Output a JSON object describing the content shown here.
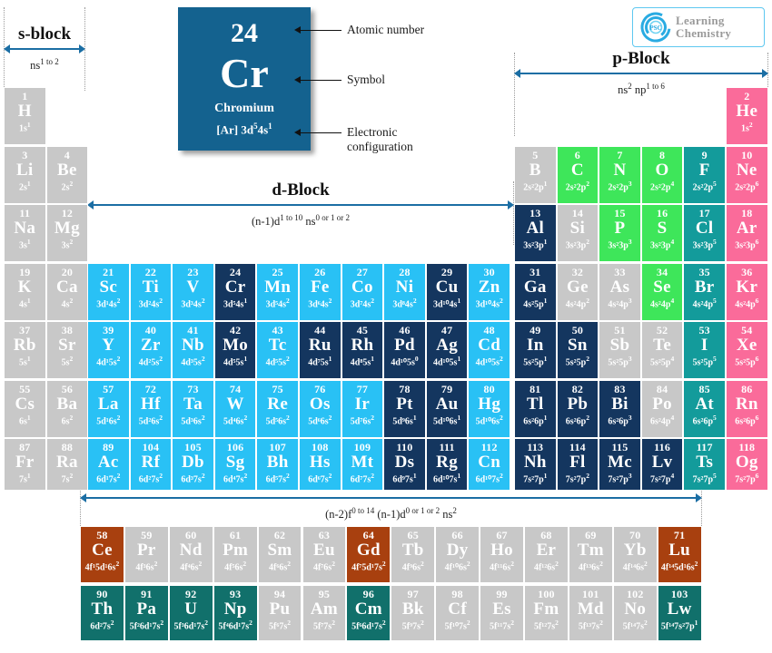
{
  "logo": {
    "mark": "PSC",
    "line1": "Learning",
    "line2": "Chemistry"
  },
  "legend": {
    "atomic_number": "24",
    "symbol": "Cr",
    "name": "Chromium",
    "configuration": "[Ar] 3d5 4s1",
    "configuration_display": "[Ar] 3d⁵4s¹",
    "callout_atomic_number": "Atomic number",
    "callout_symbol": "Symbol",
    "callout_config_line1": "Electronic",
    "callout_config_line2": "configuration"
  },
  "blocks": {
    "s": {
      "title": "s-block",
      "sub": "ns1 to 2"
    },
    "p": {
      "title": "p-Block",
      "sub": "ns2 np1 to 6"
    },
    "d": {
      "title": "d-Block",
      "sub": "(n-1)d1 to 10 ns0 or 1 or 2"
    },
    "f": {
      "title": "f-Block",
      "sub": "(n-2)f0 to 14 (n-1)d0 or 1 or 2 ns2"
    }
  },
  "elements": [
    {
      "z": "1",
      "sym": "H",
      "cfg": "1s",
      "sup": "1",
      "color": "grey",
      "col": 1,
      "row": 1
    },
    {
      "z": "2",
      "sym": "He",
      "cfg": "1s",
      "sup": "2",
      "color": "pink",
      "col": 18,
      "row": 1
    },
    {
      "z": "3",
      "sym": "Li",
      "cfg": "2s",
      "sup": "1",
      "color": "grey",
      "col": 1,
      "row": 2
    },
    {
      "z": "4",
      "sym": "Be",
      "cfg": "2s",
      "sup": "2",
      "color": "grey",
      "col": 2,
      "row": 2
    },
    {
      "z": "5",
      "sym": "B",
      "cfg": "2s²2p",
      "sup": "1",
      "color": "grey",
      "col": 13,
      "row": 2
    },
    {
      "z": "6",
      "sym": "C",
      "cfg": "2s²2p",
      "sup": "2",
      "color": "green",
      "col": 14,
      "row": 2
    },
    {
      "z": "7",
      "sym": "N",
      "cfg": "2s²2p",
      "sup": "3",
      "color": "green",
      "col": 15,
      "row": 2
    },
    {
      "z": "8",
      "sym": "O",
      "cfg": "2s²2p",
      "sup": "4",
      "color": "green",
      "col": 16,
      "row": 2
    },
    {
      "z": "9",
      "sym": "F",
      "cfg": "2s²2p",
      "sup": "5",
      "color": "teal",
      "col": 17,
      "row": 2
    },
    {
      "z": "10",
      "sym": "Ne",
      "cfg": "2s²2p",
      "sup": "6",
      "color": "pink",
      "col": 18,
      "row": 2
    },
    {
      "z": "11",
      "sym": "Na",
      "cfg": "3s",
      "sup": "1",
      "color": "grey",
      "col": 1,
      "row": 3
    },
    {
      "z": "12",
      "sym": "Mg",
      "cfg": "3s",
      "sup": "2",
      "color": "grey",
      "col": 2,
      "row": 3
    },
    {
      "z": "13",
      "sym": "Al",
      "cfg": "3s²3p",
      "sup": "1",
      "color": "navy",
      "col": 13,
      "row": 3
    },
    {
      "z": "14",
      "sym": "Si",
      "cfg": "3s²3p",
      "sup": "2",
      "color": "grey",
      "col": 14,
      "row": 3
    },
    {
      "z": "15",
      "sym": "P",
      "cfg": "3s²3p",
      "sup": "3",
      "color": "green",
      "col": 15,
      "row": 3
    },
    {
      "z": "16",
      "sym": "S",
      "cfg": "3s²3p",
      "sup": "4",
      "color": "green",
      "col": 16,
      "row": 3
    },
    {
      "z": "17",
      "sym": "Cl",
      "cfg": "3s²3p",
      "sup": "5",
      "color": "teal",
      "col": 17,
      "row": 3
    },
    {
      "z": "18",
      "sym": "Ar",
      "cfg": "3s²3p",
      "sup": "6",
      "color": "pink",
      "col": 18,
      "row": 3
    },
    {
      "z": "19",
      "sym": "K",
      "cfg": "4s",
      "sup": "1",
      "color": "grey",
      "col": 1,
      "row": 4
    },
    {
      "z": "20",
      "sym": "Ca",
      "cfg": "4s",
      "sup": "2",
      "color": "grey",
      "col": 2,
      "row": 4
    },
    {
      "z": "21",
      "sym": "Sc",
      "cfg": "3d¹4s",
      "sup": "2",
      "color": "cyan",
      "col": 3,
      "row": 4
    },
    {
      "z": "22",
      "sym": "Ti",
      "cfg": "3d²4s",
      "sup": "2",
      "color": "cyan",
      "col": 4,
      "row": 4
    },
    {
      "z": "23",
      "sym": "V",
      "cfg": "3d³4s",
      "sup": "2",
      "color": "cyan",
      "col": 5,
      "row": 4
    },
    {
      "z": "24",
      "sym": "Cr",
      "cfg": "3d⁵4s",
      "sup": "1",
      "color": "navy",
      "col": 6,
      "row": 4
    },
    {
      "z": "25",
      "sym": "Mn",
      "cfg": "3d⁵4s",
      "sup": "2",
      "color": "cyan",
      "col": 7,
      "row": 4
    },
    {
      "z": "26",
      "sym": "Fe",
      "cfg": "3d⁶4s",
      "sup": "2",
      "color": "cyan",
      "col": 8,
      "row": 4
    },
    {
      "z": "27",
      "sym": "Co",
      "cfg": "3d⁷4s",
      "sup": "2",
      "color": "cyan",
      "col": 9,
      "row": 4
    },
    {
      "z": "28",
      "sym": "Ni",
      "cfg": "3d⁸4s",
      "sup": "2",
      "color": "cyan",
      "col": 10,
      "row": 4
    },
    {
      "z": "29",
      "sym": "Cu",
      "cfg": "3d¹⁰4s",
      "sup": "1",
      "color": "navy",
      "col": 11,
      "row": 4
    },
    {
      "z": "30",
      "sym": "Zn",
      "cfg": "3d¹⁰4s",
      "sup": "2",
      "color": "cyan",
      "col": 12,
      "row": 4
    },
    {
      "z": "31",
      "sym": "Ga",
      "cfg": "4s²5p",
      "sup": "1",
      "color": "navy",
      "col": 13,
      "row": 4
    },
    {
      "z": "32",
      "sym": "Ge",
      "cfg": "4s²4p",
      "sup": "2",
      "color": "grey",
      "col": 14,
      "row": 4
    },
    {
      "z": "33",
      "sym": "As",
      "cfg": "4s²4p",
      "sup": "3",
      "color": "grey",
      "col": 15,
      "row": 4
    },
    {
      "z": "34",
      "sym": "Se",
      "cfg": "4s²4p",
      "sup": "4",
      "color": "green",
      "col": 16,
      "row": 4
    },
    {
      "z": "35",
      "sym": "Br",
      "cfg": "4s²4p",
      "sup": "5",
      "color": "teal",
      "col": 17,
      "row": 4
    },
    {
      "z": "36",
      "sym": "Kr",
      "cfg": "4s²4p",
      "sup": "6",
      "color": "pink",
      "col": 18,
      "row": 4
    },
    {
      "z": "37",
      "sym": "Rb",
      "cfg": "5s",
      "sup": "1",
      "color": "grey",
      "col": 1,
      "row": 5
    },
    {
      "z": "38",
      "sym": "Sr",
      "cfg": "5s",
      "sup": "2",
      "color": "grey",
      "col": 2,
      "row": 5
    },
    {
      "z": "39",
      "sym": "Y",
      "cfg": "4d¹5s",
      "sup": "2",
      "color": "cyan",
      "col": 3,
      "row": 5
    },
    {
      "z": "40",
      "sym": "Zr",
      "cfg": "4d²5s",
      "sup": "2",
      "color": "cyan",
      "col": 4,
      "row": 5
    },
    {
      "z": "41",
      "sym": "Nb",
      "cfg": "4d³5s",
      "sup": "2",
      "color": "cyan",
      "col": 5,
      "row": 5
    },
    {
      "z": "42",
      "sym": "Mo",
      "cfg": "4d⁵5s",
      "sup": "1",
      "color": "navy",
      "col": 6,
      "row": 5
    },
    {
      "z": "43",
      "sym": "Tc",
      "cfg": "4d⁵5s",
      "sup": "2",
      "color": "cyan",
      "col": 7,
      "row": 5
    },
    {
      "z": "44",
      "sym": "Ru",
      "cfg": "4d⁷5s",
      "sup": "1",
      "color": "navy",
      "col": 8,
      "row": 5
    },
    {
      "z": "45",
      "sym": "Rh",
      "cfg": "4d⁸5s",
      "sup": "1",
      "color": "navy",
      "col": 9,
      "row": 5
    },
    {
      "z": "46",
      "sym": "Pd",
      "cfg": "4d¹⁰5s",
      "sup": "0",
      "color": "navy",
      "col": 10,
      "row": 5
    },
    {
      "z": "47",
      "sym": "Ag",
      "cfg": "4d¹⁰5s",
      "sup": "1",
      "color": "navy",
      "col": 11,
      "row": 5
    },
    {
      "z": "48",
      "sym": "Cd",
      "cfg": "4d¹⁰5s",
      "sup": "2",
      "color": "cyan",
      "col": 12,
      "row": 5
    },
    {
      "z": "49",
      "sym": "In",
      "cfg": "5s²5p",
      "sup": "1",
      "color": "navy",
      "col": 13,
      "row": 5
    },
    {
      "z": "50",
      "sym": "Sn",
      "cfg": "5s²5p",
      "sup": "2",
      "color": "navy",
      "col": 14,
      "row": 5
    },
    {
      "z": "51",
      "sym": "Sb",
      "cfg": "5s²5p",
      "sup": "3",
      "color": "grey",
      "col": 15,
      "row": 5
    },
    {
      "z": "52",
      "sym": "Te",
      "cfg": "5s²5p",
      "sup": "4",
      "color": "grey",
      "col": 16,
      "row": 5
    },
    {
      "z": "53",
      "sym": "I",
      "cfg": "5s²5p",
      "sup": "5",
      "color": "teal",
      "col": 17,
      "row": 5
    },
    {
      "z": "54",
      "sym": "Xe",
      "cfg": "5s²5p",
      "sup": "6",
      "color": "pink",
      "col": 18,
      "row": 5
    },
    {
      "z": "55",
      "sym": "Cs",
      "cfg": "6s",
      "sup": "1",
      "color": "grey",
      "col": 1,
      "row": 6
    },
    {
      "z": "56",
      "sym": "Ba",
      "cfg": "6s",
      "sup": "2",
      "color": "grey",
      "col": 2,
      "row": 6
    },
    {
      "z": "57",
      "sym": "La",
      "cfg": "5d¹6s",
      "sup": "2",
      "color": "cyan",
      "col": 3,
      "row": 6
    },
    {
      "z": "72",
      "sym": "Hf",
      "cfg": "5d²6s",
      "sup": "2",
      "color": "cyan",
      "col": 4,
      "row": 6
    },
    {
      "z": "73",
      "sym": "Ta",
      "cfg": "5d³6s",
      "sup": "2",
      "color": "cyan",
      "col": 5,
      "row": 6
    },
    {
      "z": "74",
      "sym": "W",
      "cfg": "5d⁴6s",
      "sup": "2",
      "color": "cyan",
      "col": 6,
      "row": 6
    },
    {
      "z": "75",
      "sym": "Re",
      "cfg": "5d⁵6s",
      "sup": "2",
      "color": "cyan",
      "col": 7,
      "row": 6
    },
    {
      "z": "76",
      "sym": "Os",
      "cfg": "5d⁶6s",
      "sup": "2",
      "color": "cyan",
      "col": 8,
      "row": 6
    },
    {
      "z": "77",
      "sym": "Ir",
      "cfg": "5d⁷6s",
      "sup": "2",
      "color": "cyan",
      "col": 9,
      "row": 6
    },
    {
      "z": "78",
      "sym": "Pt",
      "cfg": "5d⁹6s",
      "sup": "1",
      "color": "navy",
      "col": 10,
      "row": 6
    },
    {
      "z": "79",
      "sym": "Au",
      "cfg": "5d¹⁰6s",
      "sup": "1",
      "color": "navy",
      "col": 11,
      "row": 6
    },
    {
      "z": "80",
      "sym": "Hg",
      "cfg": "5d¹⁰6s",
      "sup": "2",
      "color": "cyan",
      "col": 12,
      "row": 6
    },
    {
      "z": "81",
      "sym": "Tl",
      "cfg": "6s²6p",
      "sup": "1",
      "color": "navy",
      "col": 13,
      "row": 6
    },
    {
      "z": "82",
      "sym": "Pb",
      "cfg": "6s²6p",
      "sup": "2",
      "color": "navy",
      "col": 14,
      "row": 6
    },
    {
      "z": "83",
      "sym": "Bi",
      "cfg": "6s²6p",
      "sup": "3",
      "color": "navy",
      "col": 15,
      "row": 6
    },
    {
      "z": "84",
      "sym": "Po",
      "cfg": "6s²4p",
      "sup": "4",
      "color": "grey",
      "col": 16,
      "row": 6
    },
    {
      "z": "85",
      "sym": "At",
      "cfg": "6s²6p",
      "sup": "5",
      "color": "teal",
      "col": 17,
      "row": 6
    },
    {
      "z": "86",
      "sym": "Rn",
      "cfg": "6s²6p",
      "sup": "6",
      "color": "pink",
      "col": 18,
      "row": 6
    },
    {
      "z": "87",
      "sym": "Fr",
      "cfg": "7s",
      "sup": "1",
      "color": "grey",
      "col": 1,
      "row": 7
    },
    {
      "z": "88",
      "sym": "Ra",
      "cfg": "7s",
      "sup": "2",
      "color": "grey",
      "col": 2,
      "row": 7
    },
    {
      "z": "89",
      "sym": "Ac",
      "cfg": "6d¹7s",
      "sup": "2",
      "color": "cyan",
      "col": 3,
      "row": 7
    },
    {
      "z": "104",
      "sym": "Rf",
      "cfg": "6d²7s",
      "sup": "2",
      "color": "cyan",
      "col": 4,
      "row": 7
    },
    {
      "z": "105",
      "sym": "Db",
      "cfg": "6d³7s",
      "sup": "2",
      "color": "cyan",
      "col": 5,
      "row": 7
    },
    {
      "z": "106",
      "sym": "Sg",
      "cfg": "6d⁴7s",
      "sup": "2",
      "color": "cyan",
      "col": 6,
      "row": 7
    },
    {
      "z": "107",
      "sym": "Bh",
      "cfg": "6d⁵7s",
      "sup": "2",
      "color": "cyan",
      "col": 7,
      "row": 7
    },
    {
      "z": "108",
      "sym": "Hs",
      "cfg": "6d⁶7s",
      "sup": "2",
      "color": "cyan",
      "col": 8,
      "row": 7
    },
    {
      "z": "109",
      "sym": "Mt",
      "cfg": "6d⁷7s",
      "sup": "2",
      "color": "cyan",
      "col": 9,
      "row": 7
    },
    {
      "z": "110",
      "sym": "Ds",
      "cfg": "6d⁹7s",
      "sup": "1",
      "color": "navy",
      "col": 10,
      "row": 7
    },
    {
      "z": "111",
      "sym": "Rg",
      "cfg": "6d¹⁰7s",
      "sup": "1",
      "color": "navy",
      "col": 11,
      "row": 7
    },
    {
      "z": "112",
      "sym": "Cn",
      "cfg": "6d¹⁰7s",
      "sup": "2",
      "color": "cyan",
      "col": 12,
      "row": 7
    },
    {
      "z": "113",
      "sym": "Nh",
      "cfg": "7s²7p",
      "sup": "1",
      "color": "navy",
      "col": 13,
      "row": 7
    },
    {
      "z": "114",
      "sym": "Fl",
      "cfg": "7s²7p",
      "sup": "2",
      "color": "navy",
      "col": 14,
      "row": 7
    },
    {
      "z": "115",
      "sym": "Mc",
      "cfg": "7s²7p",
      "sup": "3",
      "color": "navy",
      "col": 15,
      "row": 7
    },
    {
      "z": "116",
      "sym": "Lv",
      "cfg": "7s²7p",
      "sup": "4",
      "color": "navy",
      "col": 16,
      "row": 7
    },
    {
      "z": "117",
      "sym": "Ts",
      "cfg": "7s²7p",
      "sup": "5",
      "color": "teal",
      "col": 17,
      "row": 7
    },
    {
      "z": "118",
      "sym": "Og",
      "cfg": "7s²7p",
      "sup": "6",
      "color": "pink",
      "col": 18,
      "row": 7
    }
  ],
  "lanthanides": [
    {
      "z": "58",
      "sym": "Ce",
      "cfg": "4f¹5d¹6s",
      "sup": "2",
      "color": "brown"
    },
    {
      "z": "59",
      "sym": "Pr",
      "cfg": "4f³6s",
      "sup": "2",
      "color": "grey"
    },
    {
      "z": "60",
      "sym": "Nd",
      "cfg": "4f⁴6s",
      "sup": "2",
      "color": "grey"
    },
    {
      "z": "61",
      "sym": "Pm",
      "cfg": "4f⁵6s",
      "sup": "2",
      "color": "grey"
    },
    {
      "z": "62",
      "sym": "Sm",
      "cfg": "4f⁶6s",
      "sup": "2",
      "color": "grey"
    },
    {
      "z": "63",
      "sym": "Eu",
      "cfg": "4f⁷6s",
      "sup": "2",
      "color": "grey"
    },
    {
      "z": "64",
      "sym": "Gd",
      "cfg": "4f⁷5d¹7s",
      "sup": "2",
      "color": "brown"
    },
    {
      "z": "65",
      "sym": "Tb",
      "cfg": "4f⁹6s",
      "sup": "2",
      "color": "grey"
    },
    {
      "z": "66",
      "sym": "Dy",
      "cfg": "4f¹⁰6s",
      "sup": "2",
      "color": "grey"
    },
    {
      "z": "67",
      "sym": "Ho",
      "cfg": "4f¹¹6s",
      "sup": "2",
      "color": "grey"
    },
    {
      "z": "68",
      "sym": "Er",
      "cfg": "4f¹²6s",
      "sup": "2",
      "color": "grey"
    },
    {
      "z": "69",
      "sym": "Tm",
      "cfg": "4f¹³6s",
      "sup": "2",
      "color": "grey"
    },
    {
      "z": "70",
      "sym": "Yb",
      "cfg": "4f¹⁴6s",
      "sup": "2",
      "color": "grey"
    },
    {
      "z": "71",
      "sym": "Lu",
      "cfg": "4f¹⁴5d¹6s",
      "sup": "2",
      "color": "brown"
    }
  ],
  "actinides": [
    {
      "z": "90",
      "sym": "Th",
      "cfg": "6d²7s",
      "sup": "2",
      "color": "dteal"
    },
    {
      "z": "91",
      "sym": "Pa",
      "cfg": "5f²6d¹7s",
      "sup": "2",
      "color": "dteal"
    },
    {
      "z": "92",
      "sym": "U",
      "cfg": "5f³6d¹7s",
      "sup": "2",
      "color": "dteal"
    },
    {
      "z": "93",
      "sym": "Np",
      "cfg": "5f⁴6d¹7s",
      "sup": "2",
      "color": "dteal"
    },
    {
      "z": "94",
      "sym": "Pu",
      "cfg": "5f⁶7s",
      "sup": "2",
      "color": "grey"
    },
    {
      "z": "95",
      "sym": "Am",
      "cfg": "5f⁷7s",
      "sup": "2",
      "color": "grey"
    },
    {
      "z": "96",
      "sym": "Cm",
      "cfg": "5f⁶6d¹7s",
      "sup": "2",
      "color": "dteal"
    },
    {
      "z": "97",
      "sym": "Bk",
      "cfg": "5f⁹7s",
      "sup": "2",
      "color": "grey"
    },
    {
      "z": "98",
      "sym": "Cf",
      "cfg": "5f¹⁰7s",
      "sup": "2",
      "color": "grey"
    },
    {
      "z": "99",
      "sym": "Es",
      "cfg": "5f¹¹7s",
      "sup": "2",
      "color": "grey"
    },
    {
      "z": "100",
      "sym": "Fm",
      "cfg": "5f¹²7s",
      "sup": "2",
      "color": "grey"
    },
    {
      "z": "101",
      "sym": "Md",
      "cfg": "5f¹³7s",
      "sup": "2",
      "color": "grey"
    },
    {
      "z": "102",
      "sym": "No",
      "cfg": "5f¹⁴7s",
      "sup": "2",
      "color": "grey"
    },
    {
      "z": "103",
      "sym": "Lw",
      "cfg": "5f¹⁴7s²7p",
      "sup": "1",
      "color": "dteal"
    }
  ],
  "colors": {
    "grey": "#c8c8c8",
    "cyan": "#29c1f5",
    "navy": "#14365f",
    "green": "#3ee65a",
    "teal": "#139b9b",
    "pink": "#fa6b9a",
    "brown": "#a8400f",
    "dteal": "#11706b",
    "legend_bg": "#14628f",
    "arrow": "#1b6ea4"
  }
}
